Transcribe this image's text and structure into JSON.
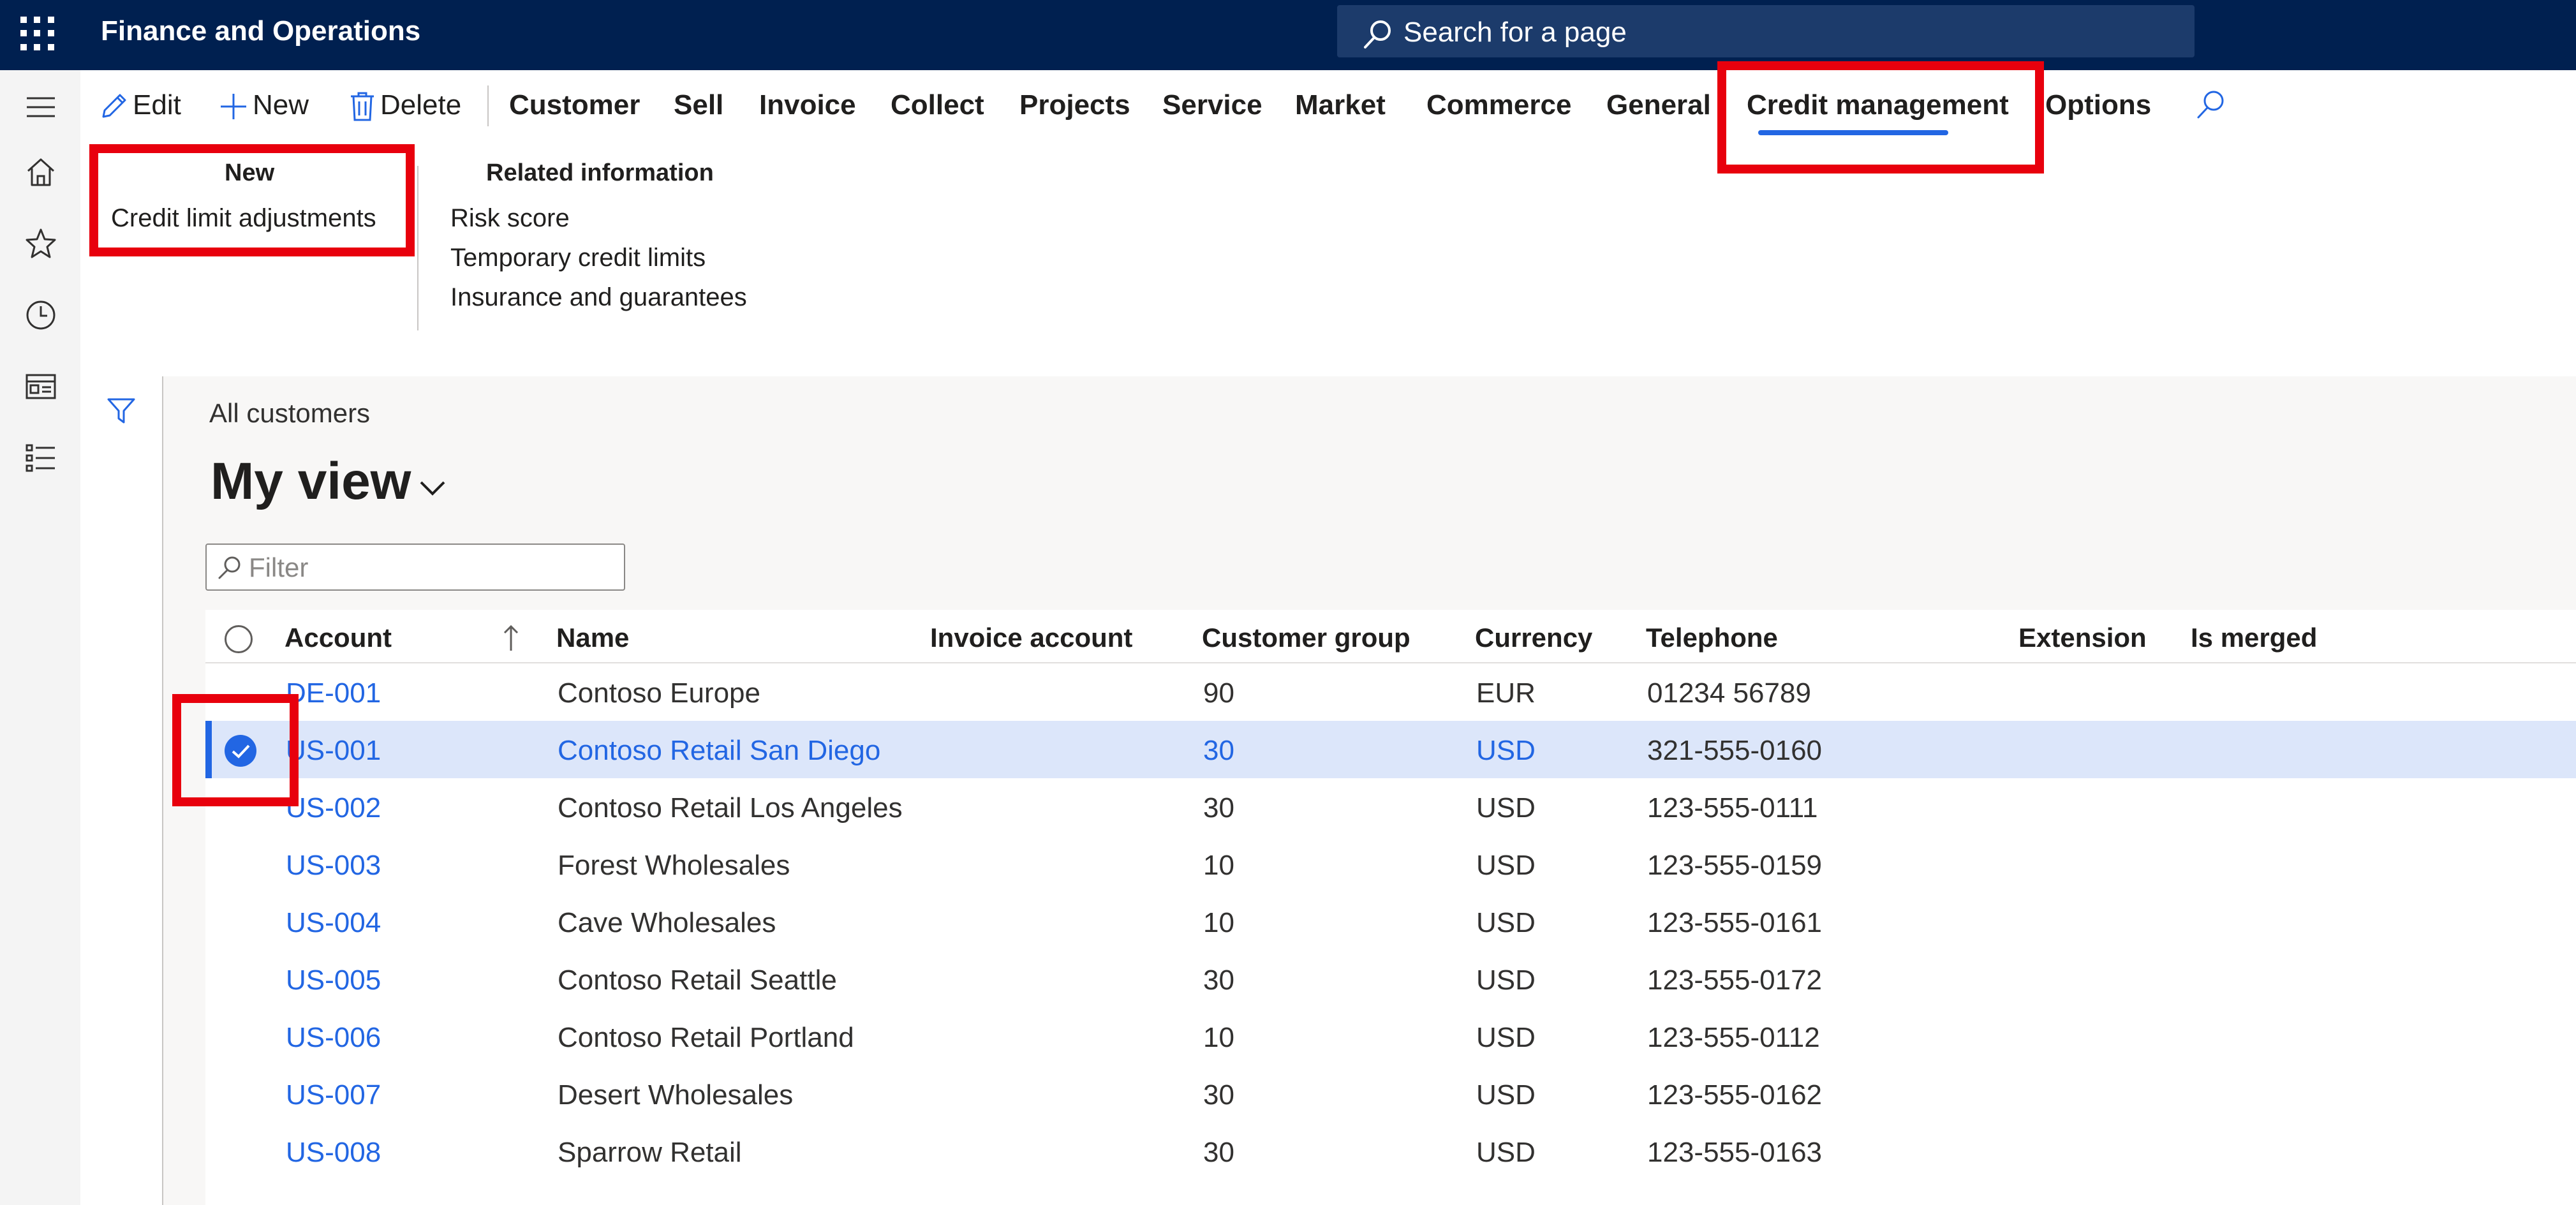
{
  "topbar": {
    "app_title": "Finance and Operations",
    "search_label": "Search for a page"
  },
  "action_pane": {
    "edit": "Edit",
    "new": "New",
    "delete": "Delete",
    "tabs": [
      "Customer",
      "Sell",
      "Invoice",
      "Collect",
      "Projects",
      "Service",
      "Market",
      "Commerce",
      "General",
      "Credit management",
      "Options"
    ],
    "active_tab": "Credit management",
    "groups": {
      "new": {
        "header": "New",
        "items": [
          "Credit limit adjustments"
        ]
      },
      "related": {
        "header": "Related information",
        "items": [
          "Risk score",
          "Temporary credit limits",
          "Insurance and guarantees"
        ]
      }
    }
  },
  "page": {
    "breadcrumb": "All customers",
    "view_title": "My view",
    "filter_placeholder": "Filter"
  },
  "grid": {
    "columns": [
      "Account",
      "Name",
      "Invoice account",
      "Customer group",
      "Currency",
      "Telephone",
      "Extension",
      "Is merged"
    ],
    "rows": [
      {
        "account": "DE-001",
        "name": "Contoso Europe",
        "invoice_account": "",
        "group": "90",
        "currency": "EUR",
        "telephone": "01234 56789"
      },
      {
        "account": "US-001",
        "name": "Contoso Retail San Diego",
        "invoice_account": "",
        "group": "30",
        "currency": "USD",
        "telephone": "321-555-0160"
      },
      {
        "account": "US-002",
        "name": "Contoso Retail Los Angeles",
        "invoice_account": "",
        "group": "30",
        "currency": "USD",
        "telephone": "123-555-0111"
      },
      {
        "account": "US-003",
        "name": "Forest Wholesales",
        "invoice_account": "",
        "group": "10",
        "currency": "USD",
        "telephone": "123-555-0159"
      },
      {
        "account": "US-004",
        "name": "Cave Wholesales",
        "invoice_account": "",
        "group": "10",
        "currency": "USD",
        "telephone": "123-555-0161"
      },
      {
        "account": "US-005",
        "name": "Contoso Retail Seattle",
        "invoice_account": "",
        "group": "30",
        "currency": "USD",
        "telephone": "123-555-0172"
      },
      {
        "account": "US-006",
        "name": "Contoso Retail Portland",
        "invoice_account": "",
        "group": "10",
        "currency": "USD",
        "telephone": "123-555-0112"
      },
      {
        "account": "US-007",
        "name": "Desert Wholesales",
        "invoice_account": "",
        "group": "30",
        "currency": "USD",
        "telephone": "123-555-0162"
      },
      {
        "account": "US-008",
        "name": "Sparrow Retail",
        "invoice_account": "",
        "group": "30",
        "currency": "USD",
        "telephone": "123-555-0163"
      }
    ],
    "selected_row": 1
  },
  "colors": {
    "topbar": "#002050",
    "accent": "#2266e3",
    "highlight": "#e8000d",
    "selected_row": "#dce6fa"
  }
}
